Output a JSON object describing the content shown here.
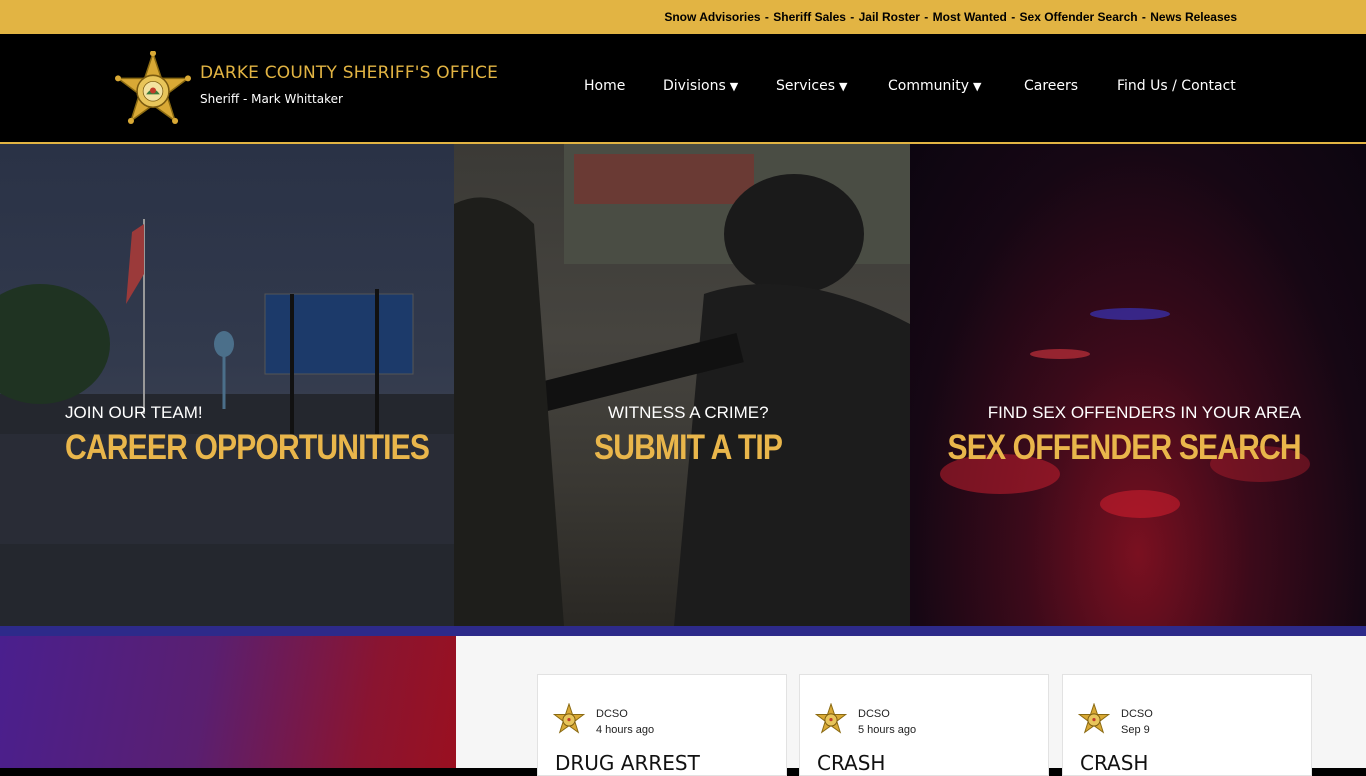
{
  "colors": {
    "accent": "#e2b443",
    "header_bg": "#000000",
    "stripe": "#2d2a8a"
  },
  "topbar": {
    "links": [
      {
        "label": "Snow Advisories"
      },
      {
        "label": "Sheriff Sales"
      },
      {
        "label": "Jail Roster"
      },
      {
        "label": "Most Wanted"
      },
      {
        "label": "Sex Offender Search"
      },
      {
        "label": "News Releases"
      }
    ],
    "separator": " - "
  },
  "header": {
    "logo_icon": "sheriff-star-badge-icon",
    "org_name": "DARKE COUNTY SHERIFF'S OFFICE",
    "sub": "Sheriff - Mark Whittaker"
  },
  "nav": {
    "items": [
      {
        "label": "Home",
        "dropdown": false
      },
      {
        "label": "Divisions",
        "dropdown": true
      },
      {
        "label": "Services",
        "dropdown": true
      },
      {
        "label": "Community",
        "dropdown": true
      },
      {
        "label": "Careers",
        "dropdown": false
      },
      {
        "label": "Find Us / Contact",
        "dropdown": false
      }
    ],
    "caret": "▼"
  },
  "hero": {
    "panels": [
      {
        "kicker": "JOIN OUR TEAM!",
        "title": "CAREER OPPORTUNITIES"
      },
      {
        "kicker": "WITNESS A CRIME?",
        "title": "SUBMIT A TIP"
      },
      {
        "kicker": "FIND SEX OFFENDERS IN YOUR AREA",
        "title": "SEX OFFENDER SEARCH"
      }
    ]
  },
  "feed": {
    "cards": [
      {
        "author": "DCSO",
        "time": "4 hours ago",
        "headline": "DRUG ARREST"
      },
      {
        "author": "DCSO",
        "time": "5 hours ago",
        "headline": "CRASH"
      },
      {
        "author": "DCSO",
        "time": "Sep 9",
        "headline": "CRASH"
      }
    ]
  }
}
